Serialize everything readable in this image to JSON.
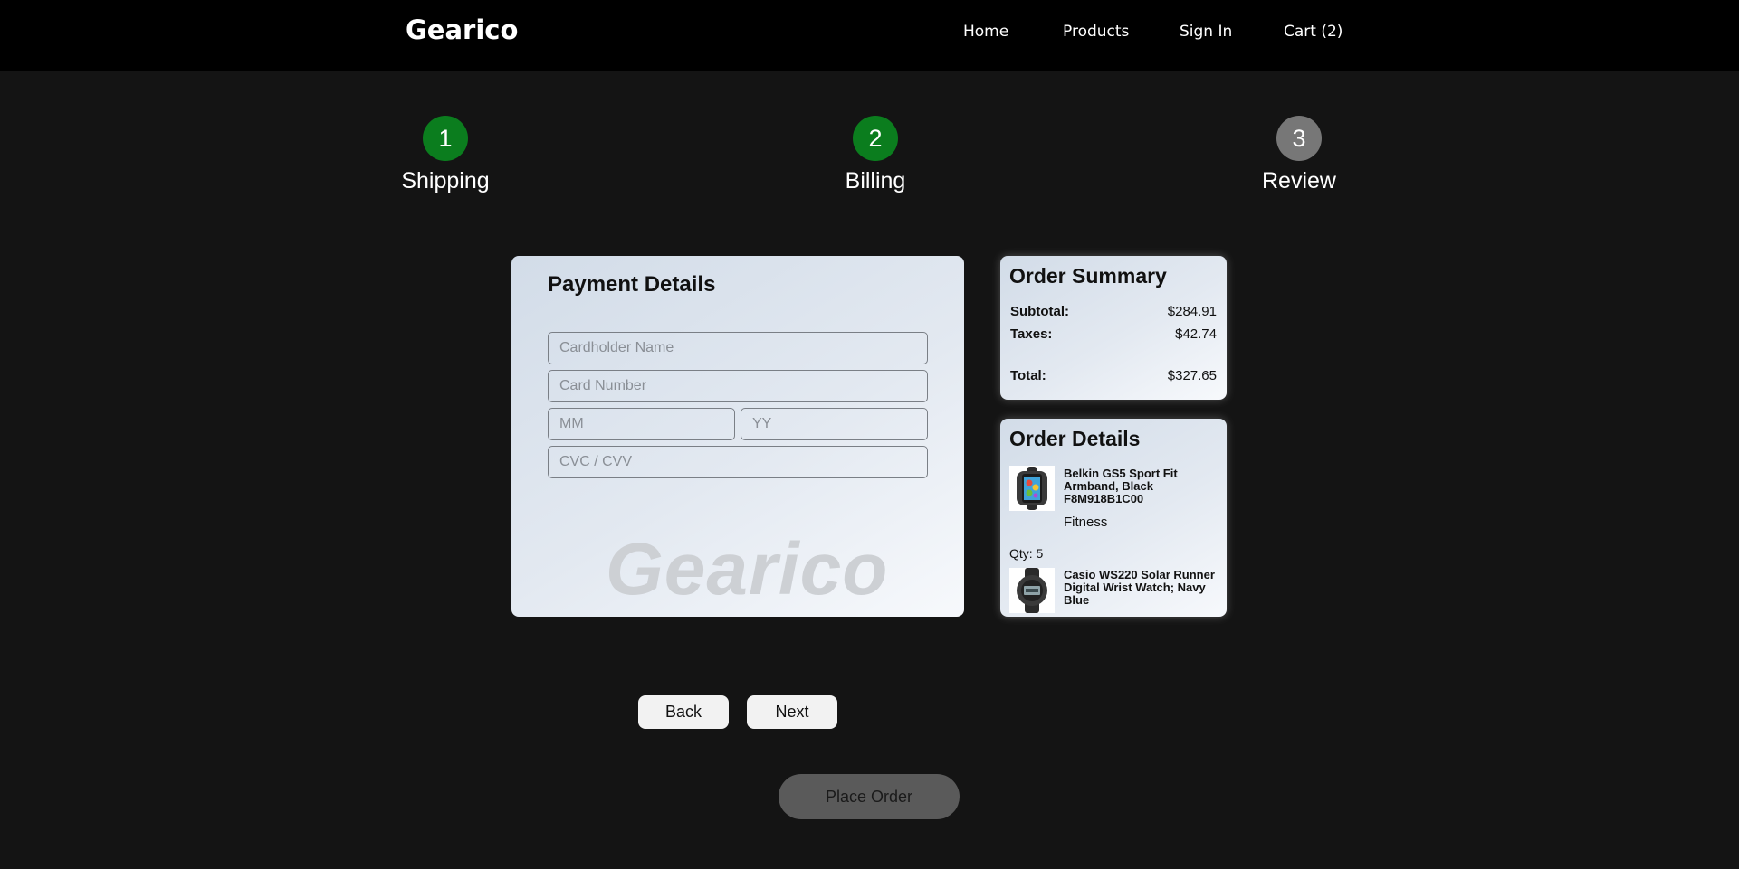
{
  "header": {
    "brand": "Gearico",
    "nav": {
      "home": "Home",
      "products": "Products",
      "sign_in": "Sign In",
      "cart": "Cart (2)"
    }
  },
  "steps": [
    {
      "number": "1",
      "label": "Shipping",
      "status": "complete",
      "color": "#0b7d1e"
    },
    {
      "number": "2",
      "label": "Billing",
      "status": "active",
      "color": "#0b7d1e"
    },
    {
      "number": "3",
      "label": "Review",
      "status": "pending",
      "color": "#777777"
    }
  ],
  "payment": {
    "title": "Payment Details",
    "cardholder_placeholder": "Cardholder Name",
    "card_number_placeholder": "Card Number",
    "month_placeholder": "MM",
    "year_placeholder": "YY",
    "cvc_placeholder": "CVC / CVV",
    "watermark": "Gearico"
  },
  "summary": {
    "title": "Order Summary",
    "subtotal_label": "Subtotal:",
    "subtotal_value": "$284.91",
    "taxes_label": "Taxes:",
    "taxes_value": "$42.74",
    "total_label": "Total:",
    "total_value": "$327.65"
  },
  "details": {
    "title": "Order Details",
    "items": [
      {
        "name": "Belkin GS5 Sport Fit Armband, Black F8M918B1C00",
        "category": "Fitness",
        "qty": "Qty: 5",
        "icon": "armband-phone-icon"
      },
      {
        "name": "Casio WS220 Solar Runner Digital Wrist Watch; Navy Blue",
        "icon": "wristwatch-icon"
      }
    ]
  },
  "actions": {
    "back": "Back",
    "next": "Next",
    "place_order": "Place Order"
  }
}
